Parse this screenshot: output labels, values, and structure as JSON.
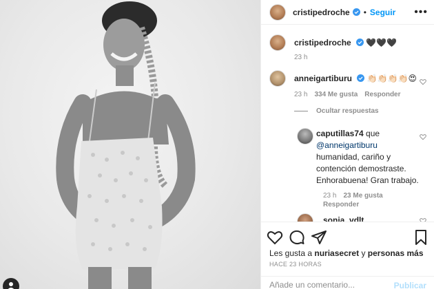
{
  "post": {
    "username": "cristipedroche",
    "follow_label": "Seguir",
    "more_label": "•••"
  },
  "caption": {
    "username": "cristipedroche",
    "text": "🖤🖤🖤",
    "time": "23 h"
  },
  "comments": [
    {
      "username": "anneigartiburu",
      "text": "👏🏻👏🏻👏🏻👏🏻😍",
      "time": "23 h",
      "likes": "334 Me gusta",
      "reply_label": "Responder",
      "hide_replies_label": "Ocultar respuestas"
    }
  ],
  "reply": {
    "username": "caputillas74",
    "inline_text": "que",
    "mention": "@anneigartiburu",
    "text": "humanidad, cariño y contención demostraste. Enhorabuena! Gran trabajo.",
    "time": "23 h",
    "likes": "23 Me gusta",
    "reply_label": "Responder"
  },
  "next_comment": {
    "username": "sonia_vdlt"
  },
  "likes_summary": {
    "prefix": "Les gusta a",
    "user": "nuriasecret",
    "connector": "y",
    "others": "personas más"
  },
  "post_time": "HACE 23 HORAS",
  "comment_box": {
    "placeholder": "Añade un comentario...",
    "publish_label": "Publicar"
  },
  "colors": {
    "link": "#0095f6",
    "muted": "#8e8e8e",
    "text": "#262626",
    "publish_disabled": "#b2dffc"
  }
}
